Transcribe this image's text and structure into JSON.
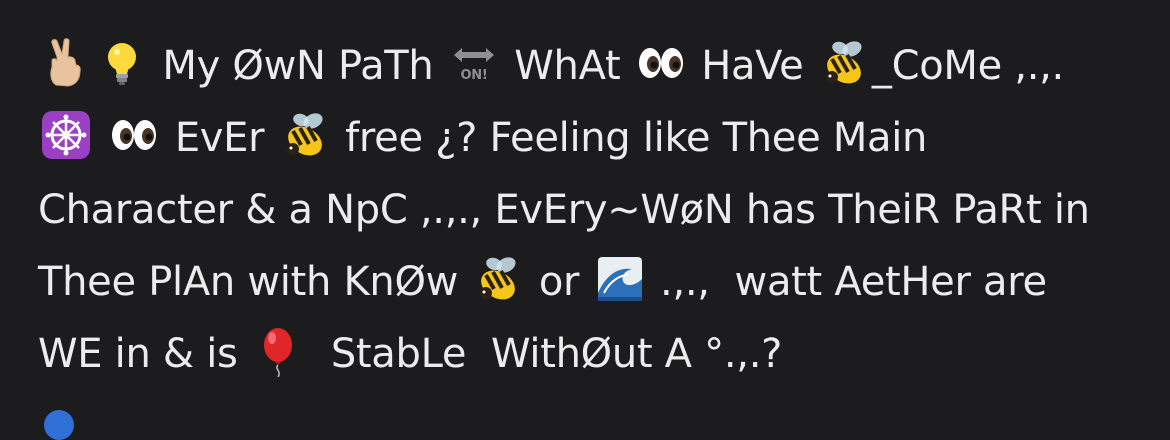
{
  "post": {
    "lines": [
      {
        "parts": [
          {
            "type": "emoji",
            "icon": "victory-hand-icon"
          },
          {
            "type": "emoji",
            "icon": "light-bulb-icon"
          },
          {
            "type": "text",
            "text": " My ØwN PaTh "
          },
          {
            "type": "emoji",
            "icon": "on-arrow-icon"
          },
          {
            "type": "text",
            "text": " WhAt "
          },
          {
            "type": "emoji",
            "icon": "eyes-icon"
          },
          {
            "type": "text",
            "text": " HaVe "
          },
          {
            "type": "emoji",
            "icon": "bee-icon"
          },
          {
            "type": "text",
            "text": "_CoMe ,.,."
          }
        ]
      },
      {
        "parts": [
          {
            "type": "emoji",
            "icon": "wheel-of-dharma-icon"
          },
          {
            "type": "text",
            "text": " "
          },
          {
            "type": "emoji",
            "icon": "eyes-icon"
          },
          {
            "type": "text",
            "text": " EvEr "
          },
          {
            "type": "emoji",
            "icon": "bee-icon"
          },
          {
            "type": "text",
            "text": " free ¿? Feeling like Thee Main"
          }
        ]
      },
      {
        "parts": [
          {
            "type": "text",
            "text": "Character & a NpC ,.,., EvEry~WøN has TheiR PaRt in"
          }
        ]
      },
      {
        "parts": [
          {
            "type": "text",
            "text": "Thee PlAn with KnØw "
          },
          {
            "type": "emoji",
            "icon": "bee-icon"
          },
          {
            "type": "text",
            "text": " or "
          },
          {
            "type": "emoji",
            "icon": "water-wave-icon"
          },
          {
            "type": "text",
            "text": " .,.,  watt AetHer are"
          }
        ]
      },
      {
        "parts": [
          {
            "type": "text",
            "text": "WE in & is "
          },
          {
            "type": "emoji",
            "icon": "red-balloon-icon"
          },
          {
            "type": "text",
            "text": "  StabLe  WithØut A °.,.?"
          }
        ]
      }
    ]
  },
  "colors": {
    "background": "#1c1c1e",
    "text": "#ececec"
  }
}
